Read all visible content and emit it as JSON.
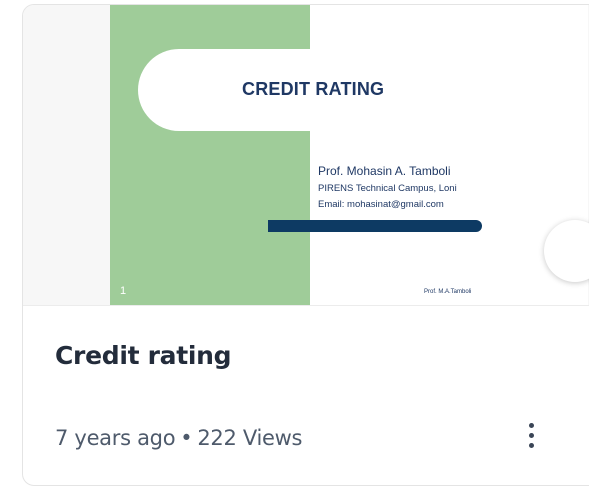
{
  "slide": {
    "title": "CREDIT RATING",
    "author": "Prof. Mohasin A. Tamboli",
    "organization": "PIRENS Technical Campus, Loni",
    "email": "Email: mohasinat@gmail.com",
    "slide_number": "1",
    "footer": "Prof. M.A.Tamboli",
    "colors": {
      "green_panel": "#9fcc99",
      "title_text": "#1f3864",
      "bar": "#0d3a63"
    }
  },
  "card": {
    "title": "Credit rating",
    "age": "7 years ago",
    "separator": "•",
    "views": "222 Views",
    "more_icon": "vertical-ellipsis-icon",
    "next_icon": "chevron-right-icon"
  }
}
